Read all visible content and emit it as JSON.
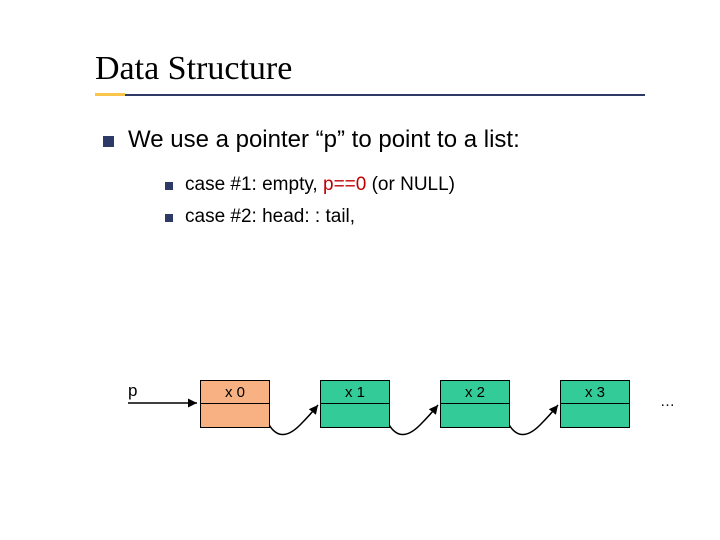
{
  "title": "Data Structure",
  "bullets": {
    "lvl1": "We use a pointer “p” to point to a list:",
    "case1_prefix": "case #1: empty, ",
    "case1_red": "p==0",
    "case1_suffix": " (or NULL)",
    "case2": "case #2: head: : tail,"
  },
  "diagram": {
    "p_label": "p",
    "nodes": [
      "x 0",
      "x 1",
      "x 2",
      "x 3"
    ],
    "ellipsis": "…"
  }
}
